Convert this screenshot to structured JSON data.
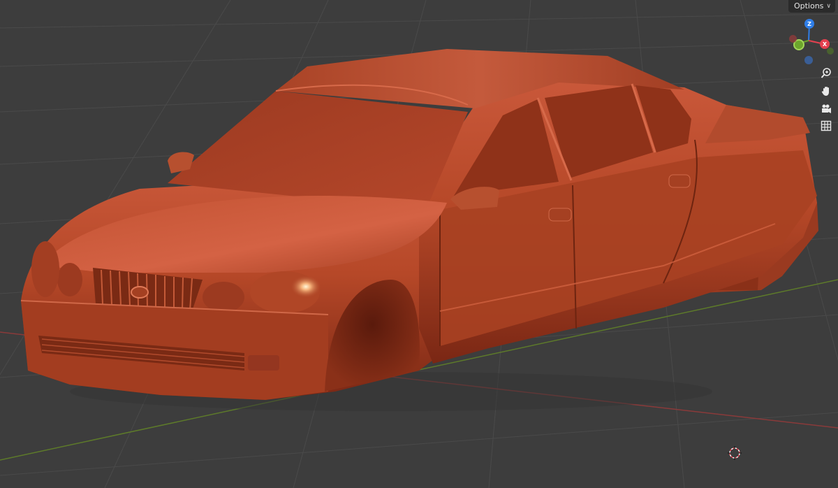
{
  "header": {
    "options_label": "Options",
    "options_icon": "chevron-down-icon"
  },
  "gizmo": {
    "axes": [
      {
        "axis": "z",
        "label": "Z",
        "color": "#2f7ee8"
      },
      {
        "axis": "x",
        "label": "X",
        "color": "#e5404f"
      },
      {
        "axis": "y",
        "label": "",
        "color": "#6da52c"
      },
      {
        "axis": "neg-x",
        "label": "",
        "color": "#8f3b3b"
      },
      {
        "axis": "neg-y",
        "label": "",
        "color": "#4c6a2c"
      },
      {
        "axis": "neg-z",
        "label": "",
        "color": "#3a5e96"
      }
    ]
  },
  "navigation": [
    {
      "name": "zoom-icon"
    },
    {
      "name": "pan-hand-icon"
    },
    {
      "name": "camera-view-icon"
    },
    {
      "name": "orthographic-grid-icon"
    }
  ],
  "scene": {
    "object_color": "#b84a2a",
    "floor_color": "#3d3d3d",
    "grid_color": "#4a4a4a",
    "x_axis_color": "#8a3a3a",
    "y_axis_color": "#5d7a2a"
  }
}
